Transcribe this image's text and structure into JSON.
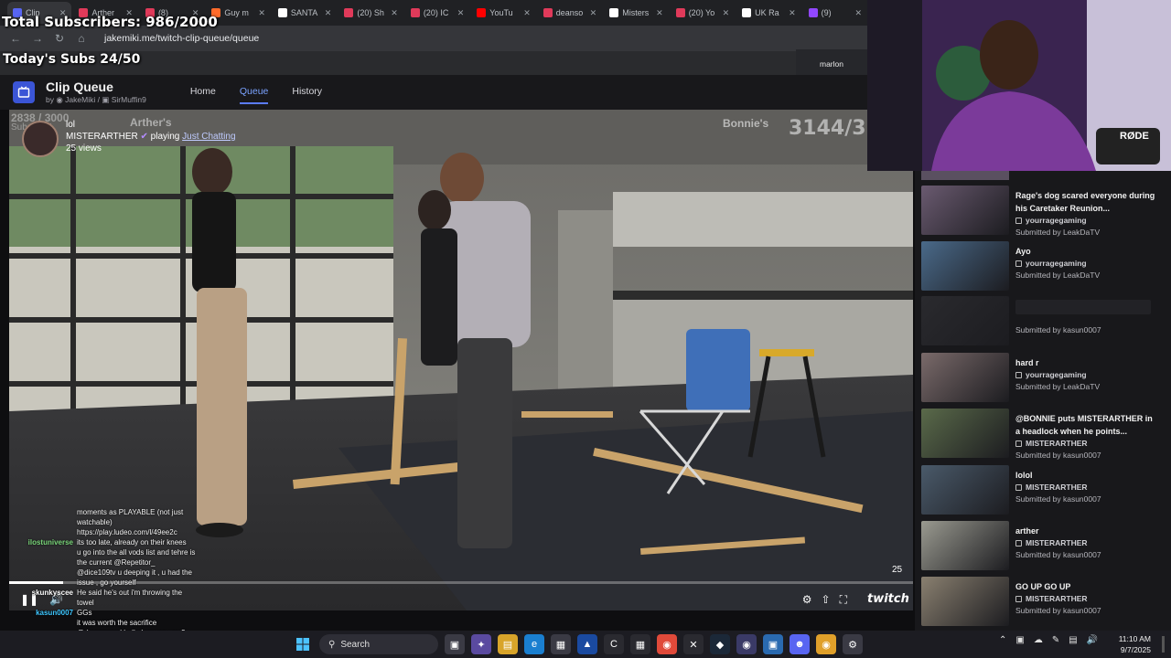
{
  "browser": {
    "tabs": [
      {
        "label": "Clip",
        "color": "#5865f2",
        "active": true
      },
      {
        "label": "Arther",
        "color": "#e03a5a"
      },
      {
        "label": "(8)",
        "color": "#e03a5a"
      },
      {
        "label": "Guy m",
        "color": "#ff6b2b"
      },
      {
        "label": "SANTA",
        "color": "#ffffff"
      },
      {
        "label": "(20) Sh",
        "color": "#e03a5a"
      },
      {
        "label": "(20) IC",
        "color": "#e03a5a"
      },
      {
        "label": "YouTu",
        "color": "#ff0000"
      },
      {
        "label": "deanso",
        "color": "#e03a5a"
      },
      {
        "label": "Misters",
        "color": "#ffffff"
      },
      {
        "label": "(20) Yo",
        "color": "#e03a5a"
      },
      {
        "label": "UK Ra",
        "color": "#ffffff"
      },
      {
        "label": "(9)",
        "color": "#9147ff"
      }
    ],
    "url": "jakemiki.me/twitch-clip-queue/queue"
  },
  "stream_overlay": {
    "total_subs": "Total Subscribers: 986/2000",
    "today_subs": "Today's Subs 24/50",
    "marlon_label": "marlon"
  },
  "app": {
    "title": "Clip Queue",
    "by_prefix": "by",
    "authors": [
      "JakeMiki",
      "SirMuffin9"
    ],
    "nav": [
      {
        "label": "Home",
        "active": false
      },
      {
        "label": "Queue",
        "active": true
      },
      {
        "label": "History",
        "active": false
      }
    ]
  },
  "player": {
    "clip_title": "lol",
    "channel": "MISTERARTHER",
    "playing_label": "playing",
    "game": "Just Chatting",
    "views": "25 views",
    "time_remaining": "25",
    "progress_fraction": 0.06,
    "overlay_counter": "3144/3",
    "overlay_bonnie": "Bonnie's",
    "overlay_arther": "Arther's",
    "overlay_ghost_1": "2838 / 3000",
    "overlay_ghost_2": "Subs: 404",
    "watermark": "twitch"
  },
  "chat": [
    {
      "user": "",
      "msg": "moments as PLAYABLE (not just watchable)",
      "color": "#ffffff"
    },
    {
      "user": "",
      "msg": "https://play.ludeo.com/l/49ee2c",
      "color": "#ffffff"
    },
    {
      "user": "ilostuniverse",
      "msg": "its too late, already on their knees",
      "color": "#7ad67a"
    },
    {
      "user": "",
      "msg": "u go into the all vods list and tehre is the current @Repetitor_",
      "color": "#ff5a5a"
    },
    {
      "user": "",
      "msg": "@dice109tv u deeping it , u had the issue , go yourself",
      "color": "#ff5a5a"
    },
    {
      "user": "skunkyscee",
      "msg": "He said he's out i'm throwing the towel",
      "color": "#ffffff"
    },
    {
      "user": "kasun0007",
      "msg": "GGs",
      "color": "#3ec7ff"
    },
    {
      "user": "",
      "msg": "it was worth the sacrifice",
      "color": "#ff5a5a"
    },
    {
      "user": "",
      "msg": "@deansocool hello how are you?",
      "color": "#4a8cff"
    }
  ],
  "queue": [
    {
      "title": "Rage's dog scared everyone during his Caretaker Reunion...",
      "channel": "yourragegaming",
      "submitted": "Submitted by LeakDaTV",
      "thumb": "#6a5a70"
    },
    {
      "title": "Ayo",
      "channel": "yourragegaming",
      "submitted": "Submitted by LeakDaTV",
      "thumb": "#4a6a8a"
    },
    {
      "title": "",
      "channel": "",
      "submitted": "Submitted by kasun0007",
      "thumb": "#2a2a2e"
    },
    {
      "title": "hard r",
      "channel": "yourragegaming",
      "submitted": "Submitted by LeakDaTV",
      "thumb": "#7a6a6a"
    },
    {
      "title": "@BONNIE puts MISTERARTHER in a headlock when he points...",
      "channel": "MISTERARTHER",
      "submitted": "Submitted by kasun0007",
      "thumb": "#5a6a4a"
    },
    {
      "title": "lolol",
      "channel": "MISTERARTHER",
      "submitted": "Submitted by kasun0007",
      "thumb": "#4a5a6a"
    },
    {
      "title": "arther",
      "channel": "MISTERARTHER",
      "submitted": "Submitted by kasun0007",
      "thumb": "#9a9a90"
    },
    {
      "title": "GO UP GO UP",
      "channel": "MISTERARTHER",
      "submitted": "Submitted by kasun0007",
      "thumb": "#8a8070"
    }
  ],
  "webcam": {
    "mic_label": "RØDE"
  },
  "taskbar": {
    "search_label": "Search",
    "time": "11:10 AM",
    "date": "9/7/2025"
  }
}
